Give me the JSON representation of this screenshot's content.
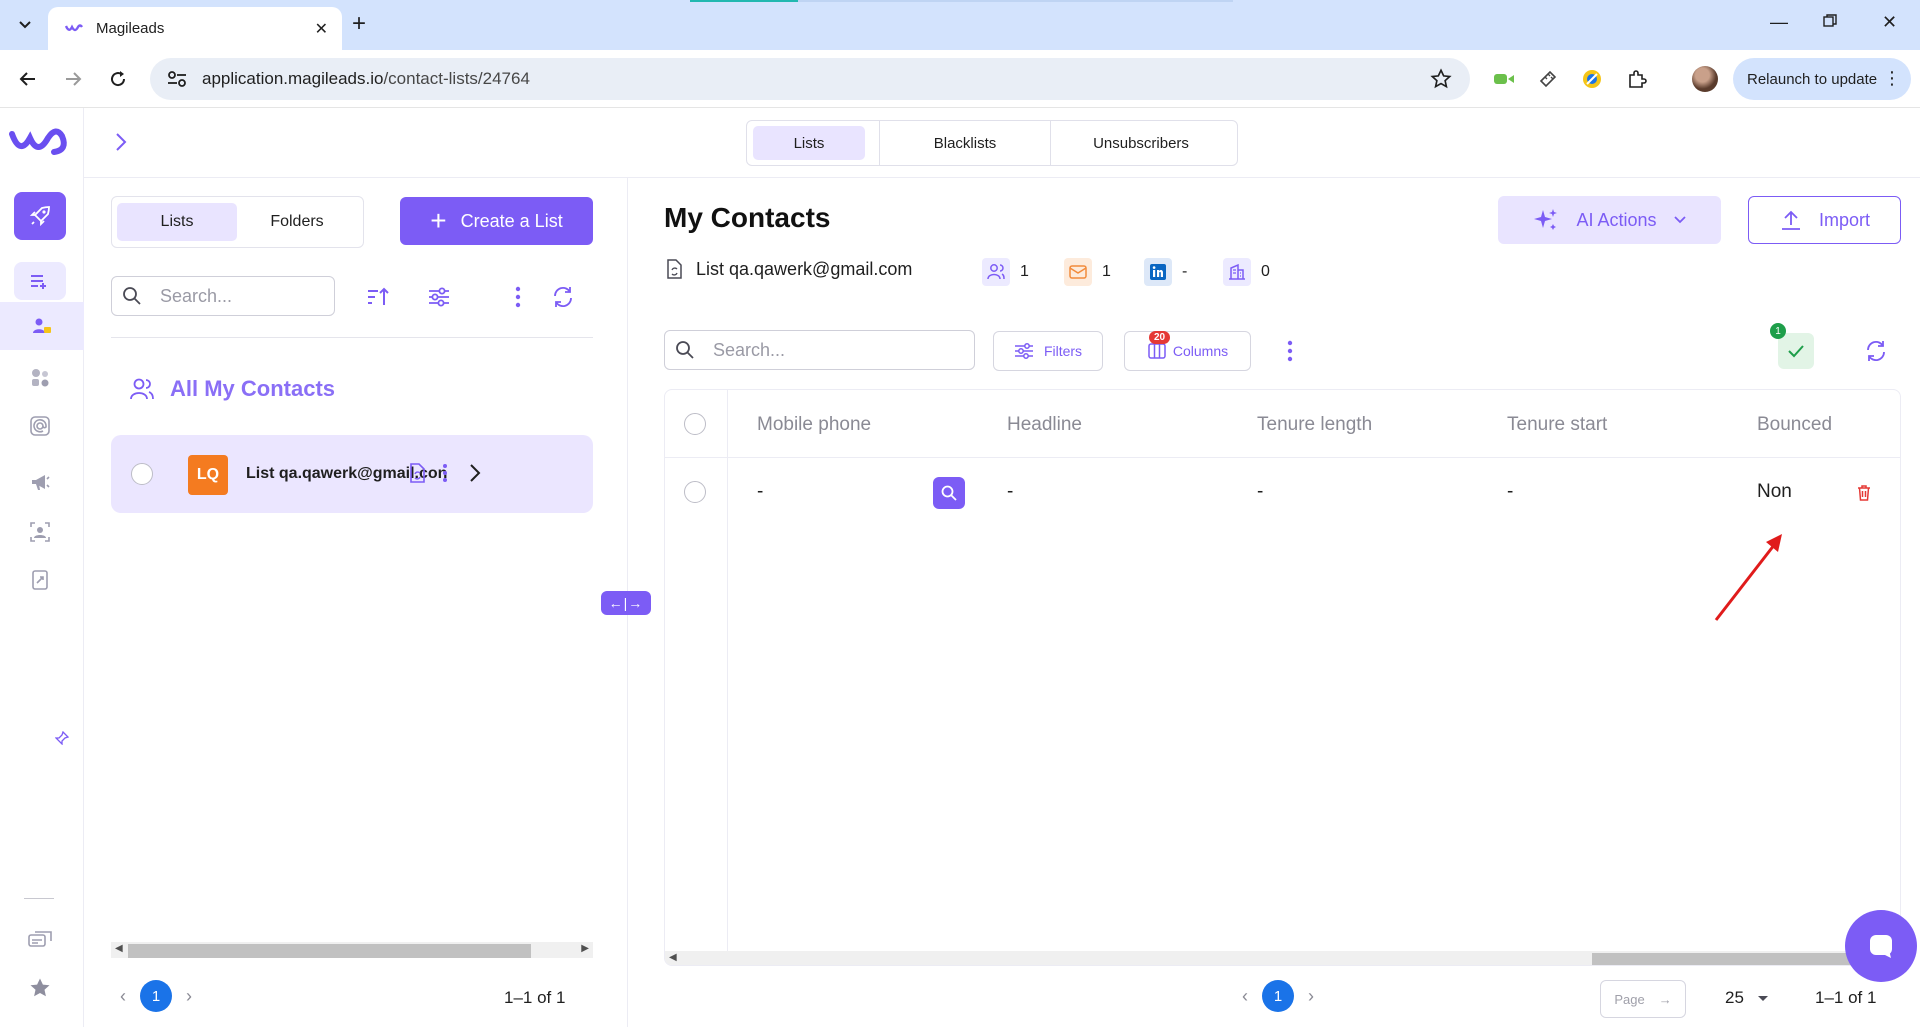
{
  "browser": {
    "tab_title": "Magileads",
    "url_host": "application.magileads.io",
    "url_path": "/contact-lists/24764",
    "relaunch_label": "Relaunch to update"
  },
  "top_tabs": [
    "Lists",
    "Blacklists",
    "Unsubscribers"
  ],
  "left_panel": {
    "toggle": [
      "Lists",
      "Folders"
    ],
    "create_label": "Create a List",
    "search_placeholder": "Search...",
    "all_contacts_label": "All My Contacts",
    "list_item": {
      "initials": "LQ",
      "name": "List qa.qawerk@gmail.con"
    },
    "page": "1",
    "page_count": "1–1 of 1"
  },
  "main": {
    "title": "My Contacts",
    "ai_actions_label": "AI Actions",
    "import_label": "Import",
    "list_name": "List qa.qawerk@gmail.com",
    "stats": {
      "contacts": "1",
      "emails": "1",
      "linkedin": "-",
      "companies": "0"
    },
    "search_placeholder": "Search...",
    "filters_label": "Filters",
    "columns_label": "Columns",
    "columns_count": "20",
    "verify_count": "1",
    "table": {
      "headers": [
        "Mobile phone",
        "Headline",
        "Tenure length",
        "Tenure start",
        "Bounced"
      ],
      "rows": [
        [
          "-",
          "-",
          "-",
          "-",
          "Non"
        ]
      ]
    },
    "page": "1",
    "page_input_placeholder": "Page",
    "per_page": "25",
    "page_count": "1–1 of 1"
  },
  "colors": {
    "accent": "#7c5cf5",
    "accent_soft": "#e9e4ff",
    "page_blue": "#1a73e8",
    "annotation": "#e01b1b"
  }
}
